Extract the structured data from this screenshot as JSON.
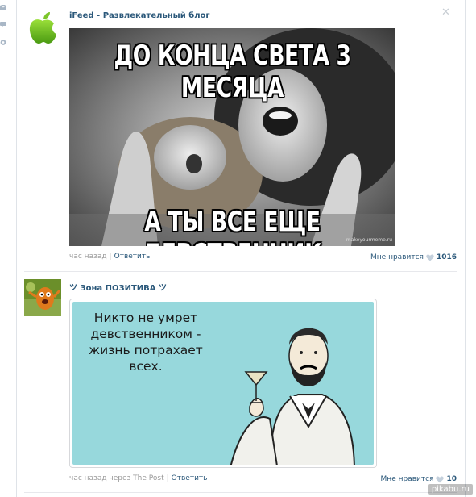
{
  "posts": [
    {
      "author": "iFeed - Развлекательный блог",
      "meme_top": "ДО КОНЦА СВЕТА 3 МЕСЯЦА",
      "meme_bottom": "А ТЫ ВСЕ ЕЩЕ ДЕВСТВЕННИК",
      "watermark": "makeyourmeme.ru",
      "time": "час назад",
      "reply": "Ответить",
      "like_label": "Мне нравится",
      "like_count": "1016"
    },
    {
      "author": "ツ Зона ПОЗИТИВА ツ",
      "card_text": "Никто не умрет девственником - жизнь потрахает всех.",
      "time": "час назад через The Post",
      "reply": "Ответить",
      "like_label": "Мне нравится",
      "like_count": "10"
    }
  ],
  "site_watermark": "pikabu.ru",
  "colors": {
    "link": "#2b587a",
    "meta": "#999999",
    "card_bg": "#97d8dc"
  }
}
